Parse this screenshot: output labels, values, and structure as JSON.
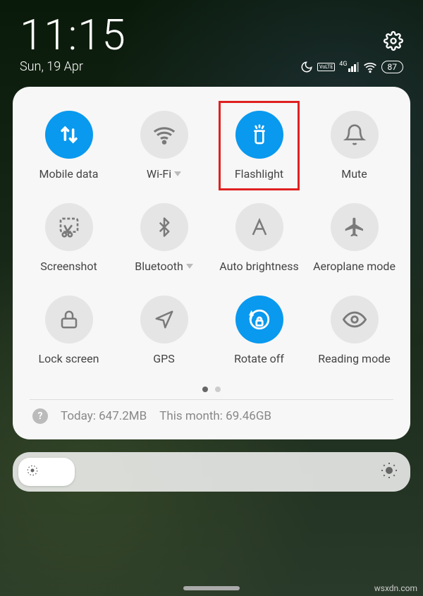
{
  "status": {
    "time": "11:15",
    "date": "Sun, 19 Apr",
    "battery": "87",
    "network_label": "4G",
    "volte_label": "VoLTE"
  },
  "tiles": [
    {
      "id": "mobile-data",
      "label": "Mobile data",
      "active": true,
      "dropdown": false,
      "icon": "arrows-updown"
    },
    {
      "id": "wifi",
      "label": "Wi-Fi",
      "active": false,
      "dropdown": true,
      "icon": "wifi"
    },
    {
      "id": "flashlight",
      "label": "Flashlight",
      "active": true,
      "dropdown": false,
      "icon": "flashlight",
      "highlighted": true
    },
    {
      "id": "mute",
      "label": "Mute",
      "active": false,
      "dropdown": false,
      "icon": "bell"
    },
    {
      "id": "screenshot",
      "label": "Screenshot",
      "active": false,
      "dropdown": false,
      "icon": "scissors"
    },
    {
      "id": "bluetooth",
      "label": "Bluetooth",
      "active": false,
      "dropdown": true,
      "icon": "bluetooth"
    },
    {
      "id": "auto-brightness",
      "label": "Auto brightness",
      "active": false,
      "dropdown": false,
      "icon": "letter-a"
    },
    {
      "id": "aeroplane-mode",
      "label": "Aeroplane mode",
      "active": false,
      "dropdown": false,
      "icon": "airplane"
    },
    {
      "id": "lock-screen",
      "label": "Lock screen",
      "active": false,
      "dropdown": false,
      "icon": "lock"
    },
    {
      "id": "gps",
      "label": "GPS",
      "active": false,
      "dropdown": false,
      "icon": "arrow-location"
    },
    {
      "id": "rotate-off",
      "label": "Rotate off",
      "active": true,
      "dropdown": false,
      "icon": "rotate-lock"
    },
    {
      "id": "reading-mode",
      "label": "Reading mode",
      "active": false,
      "dropdown": false,
      "icon": "eye"
    }
  ],
  "usage": {
    "today_label": "Today:",
    "today_value": "647.2MB",
    "month_label": "This month:",
    "month_value": "69.46GB"
  },
  "colors": {
    "accent": "#0999ef",
    "highlight": "#e02020",
    "inactive_circle": "#e5e5e5",
    "icon_inactive": "#7a7a7a"
  },
  "pagination": {
    "pages": 2,
    "active": 1
  },
  "watermark": "wsxdn.com"
}
